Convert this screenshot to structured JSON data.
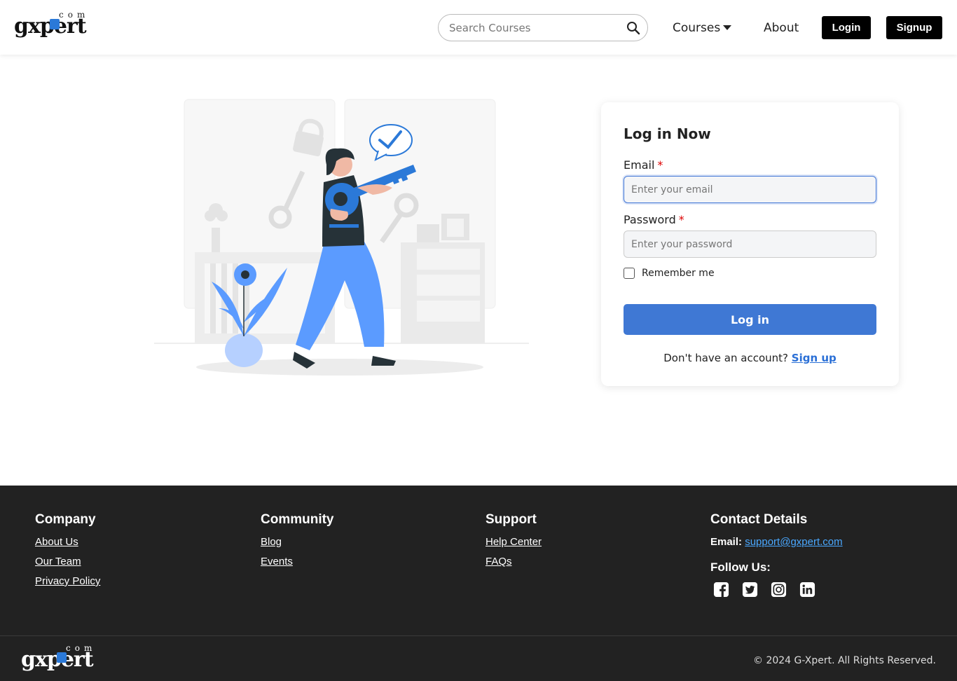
{
  "brand": {
    "logo_text": "gxpert",
    "logo_com": "com"
  },
  "header": {
    "search_placeholder": "Search Courses",
    "nav_courses": "Courses",
    "nav_about": "About",
    "login_label": "Login",
    "signup_label": "Signup"
  },
  "login": {
    "title": "Log in Now",
    "email_label": "Email",
    "email_placeholder": "Enter your email",
    "password_label": "Password",
    "password_placeholder": "Enter your password",
    "required_mark": "*",
    "remember_label": "Remember me",
    "submit_label": "Log in",
    "no_account_text": "Don't have an account?",
    "signup_link": "Sign up"
  },
  "footer": {
    "company": {
      "title": "Company",
      "links": [
        "About Us",
        "Our Team",
        "Privacy Policy"
      ]
    },
    "community": {
      "title": "Community",
      "links": [
        "Blog",
        "Events"
      ]
    },
    "support": {
      "title": "Support",
      "links": [
        "Help Center",
        "FAQs"
      ]
    },
    "contact": {
      "title": "Contact Details",
      "email_label": "Email:",
      "email": "support@gxpert.com",
      "follow_label": "Follow Us:",
      "socials": [
        "facebook-icon",
        "twitter-icon",
        "instagram-icon",
        "linkedin-icon"
      ]
    },
    "copyright": "© 2024 G-Xpert. All Rights Reserved."
  },
  "colors": {
    "accent": "#3f78d4",
    "illustration_blue": "#5b9bff",
    "footer_bg": "#222222",
    "link_blue": "#4aa8ff"
  }
}
